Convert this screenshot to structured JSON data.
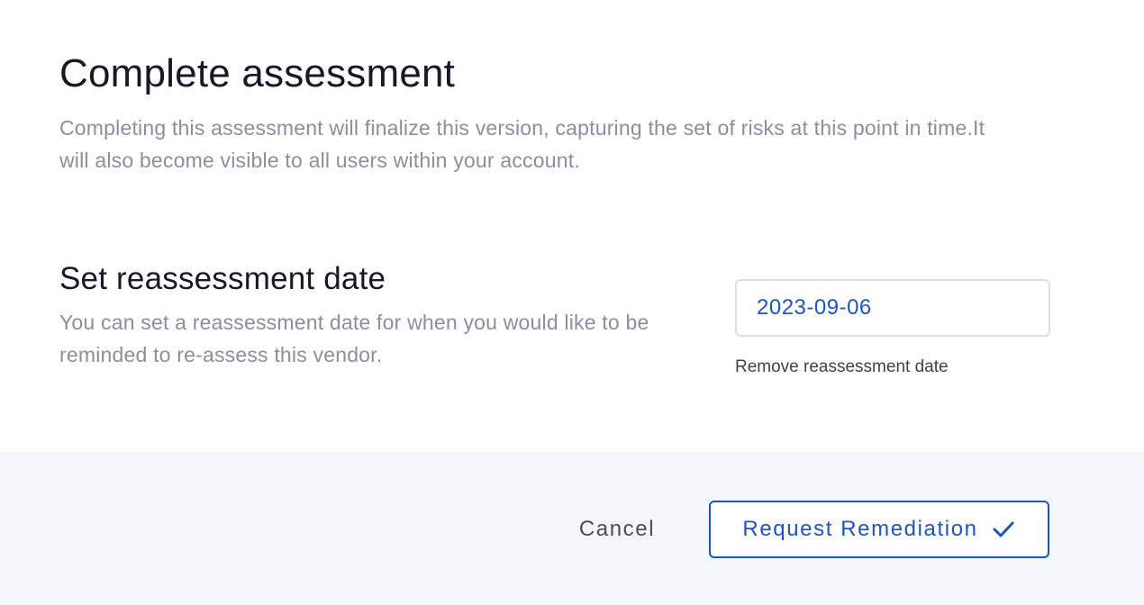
{
  "modal": {
    "title": "Complete assessment",
    "description": "Completing this assessment will finalize this version, capturing the set of risks at this point in time.It will also become visible to all users within your account."
  },
  "reassessment": {
    "title": "Set reassessment date",
    "description": "You can set a reassessment date for when you would like to be reminded to re-assess this vendor.",
    "date_value": "2023-09-06",
    "remove_label": "Remove reassessment date"
  },
  "footer": {
    "cancel_label": "Cancel",
    "primary_label": "Request Remediation",
    "primary_icon": "check-icon"
  },
  "colors": {
    "accent": "#1f55b8",
    "footer_bg": "#f3f6fa",
    "muted_text": "#8a8f9c",
    "heading_text": "#161a26"
  }
}
